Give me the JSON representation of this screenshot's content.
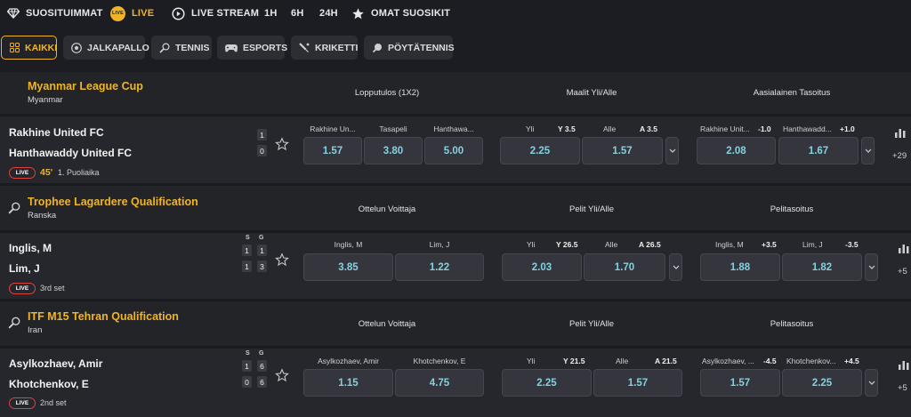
{
  "topnav": {
    "items": [
      {
        "label": "SUOSITUIMMAT",
        "icon": "diamond-icon"
      },
      {
        "label": "LIVE",
        "icon": "live-icon",
        "icon_text": "LIVE"
      },
      {
        "label": "LIVE STREAM",
        "icon": "stream-icon"
      },
      {
        "label": "1H"
      },
      {
        "label": "6H"
      },
      {
        "label": "24H"
      },
      {
        "label": "OMAT SUOSIKIT",
        "icon": "star-icon"
      }
    ]
  },
  "subnav": {
    "chips": [
      {
        "label": "KAIKKI",
        "icon": "grid-icon",
        "active": true
      },
      {
        "label": "JALKAPALLO",
        "icon": "football-icon"
      },
      {
        "label": "TENNIS",
        "icon": "tennis-icon"
      },
      {
        "label": "ESPORTS",
        "icon": "gamepad-icon"
      },
      {
        "label": "KRIKETTI",
        "icon": "cricket-icon"
      },
      {
        "label": "PÖYTÄTENNIS",
        "icon": "table-tennis-icon"
      }
    ]
  },
  "colors": {
    "accent": "#f0b429",
    "odds": "#84d2e0",
    "live": "#d9453a"
  },
  "leagues": [
    {
      "title": "Myanmar League Cup",
      "country": "Myanmar",
      "markets": [
        "Lopputulos (1X2)",
        "Maalit Yli/Alle",
        "Aasialainen Tasoitus"
      ],
      "match": {
        "home": "Rakhine United FC",
        "away": "Hanthawaddy United FC",
        "live": "LIVE",
        "minute": "45'",
        "period": "1. Puoliaika",
        "score_home": [
          "1"
        ],
        "score_away": [
          "0"
        ],
        "odds": [
          {
            "label": "Rakhine Un...",
            "value": "1.57"
          },
          {
            "label": "Tasapeli",
            "value": "3.80"
          },
          {
            "label": "Hanthawa...",
            "value": "5.00"
          },
          {
            "label": "Yli",
            "handicap": "Y 3.5",
            "value": "2.25"
          },
          {
            "label": "Alle",
            "handicap": "A 3.5",
            "value": "1.57"
          },
          {
            "label": "Rakhine Unit...",
            "handicap": "-1.0",
            "value": "2.08"
          },
          {
            "label": "Hanthawadd...",
            "handicap": "+1.0",
            "value": "1.67"
          }
        ],
        "more": "+29"
      }
    },
    {
      "title": "Trophee Lagardere Qualification",
      "country": "Ranska",
      "markets": [
        "Ottelun Voittaja",
        "Pelit Yli/Alle",
        "Pelitasoitus"
      ],
      "match": {
        "home": "Inglis, M",
        "away": "Lim, J",
        "live": "LIVE",
        "period": "3rd set",
        "score_labels": [
          "S",
          "G"
        ],
        "score_home": [
          "1",
          "1"
        ],
        "score_away": [
          "1",
          "3"
        ],
        "odds": [
          {
            "label": "Inglis, M",
            "value": "3.85"
          },
          {
            "label": "Lim, J",
            "value": "1.22"
          },
          {
            "label": "Yli",
            "handicap": "Y 26.5",
            "value": "2.03"
          },
          {
            "label": "Alle",
            "handicap": "A 26.5",
            "value": "1.70"
          },
          {
            "label": "Inglis, M",
            "handicap": "+3.5",
            "value": "1.88"
          },
          {
            "label": "Lim, J",
            "handicap": "-3.5",
            "value": "1.82"
          }
        ],
        "more": "+5"
      }
    },
    {
      "title": "ITF M15 Tehran Qualification",
      "country": "Iran",
      "markets": [
        "Ottelun Voittaja",
        "Pelit Yli/Alle",
        "Pelitasoitus"
      ],
      "match": {
        "home": "Asylkozhaev, Amir",
        "away": "Khotchenkov, E",
        "live": "LIVE",
        "period": "2nd set",
        "score_labels": [
          "S",
          "G"
        ],
        "score_home": [
          "1",
          "6"
        ],
        "score_away": [
          "0",
          "6"
        ],
        "odds": [
          {
            "label": "Asylkozhaev, Amir",
            "value": "1.15"
          },
          {
            "label": "Khotchenkov, E",
            "value": "4.75"
          },
          {
            "label": "Yli",
            "handicap": "Y 21.5",
            "value": "2.25"
          },
          {
            "label": "Alle",
            "handicap": "A 21.5",
            "value": "1.57"
          },
          {
            "label": "Asylkozhaev, ...",
            "handicap": "-4.5",
            "value": "1.57"
          },
          {
            "label": "Khotchenkov...",
            "handicap": "+4.5",
            "value": "2.25"
          }
        ],
        "more": "+5"
      }
    }
  ]
}
